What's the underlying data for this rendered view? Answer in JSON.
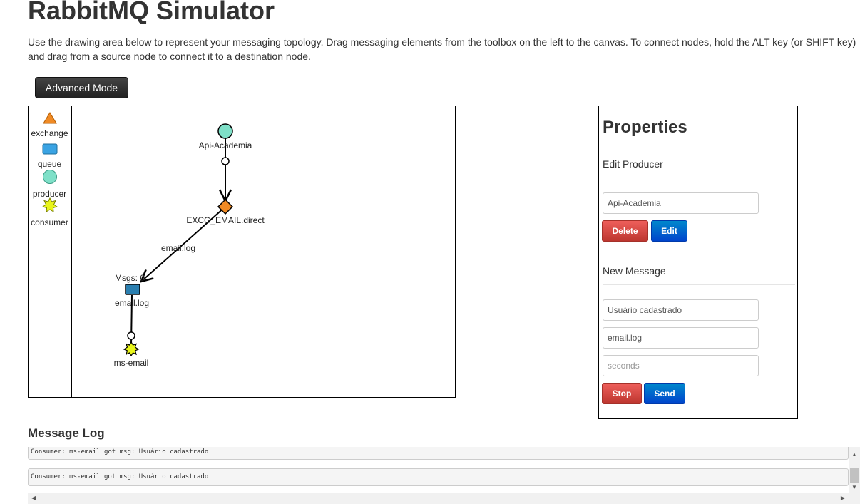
{
  "header": {
    "title": "RabbitMQ Simulator",
    "description": "Use the drawing area below to represent your messaging topology. Drag messaging elements from the toolbox on the left to the canvas. To connect nodes, hold the ALT key (or SHIFT key) and drag from a source node to connect it to a destination node.",
    "advanced_mode_label": "Advanced Mode"
  },
  "toolbox": {
    "items": [
      {
        "label": "exchange",
        "icon": "triangle-icon",
        "color": "#f08a24"
      },
      {
        "label": "queue",
        "icon": "rectangle-icon",
        "color": "#3aa3e3"
      },
      {
        "label": "producer",
        "icon": "circle-icon",
        "color": "#7fe0c8"
      },
      {
        "label": "consumer",
        "icon": "star-icon",
        "color": "#e8f51a"
      }
    ]
  },
  "diagram": {
    "nodes": {
      "producer": {
        "label": "Api-Academia",
        "color": "#7fe0c8"
      },
      "exchange": {
        "label": "EXCG_EMAIL.direct",
        "color": "#f08a24"
      },
      "queue": {
        "label": "email.log",
        "msgs_label": "Msgs: 0",
        "color": "#2a7fb0"
      },
      "consumer": {
        "label": "ms-email",
        "color": "#e8f51a"
      }
    },
    "binding_label": "email.log"
  },
  "properties": {
    "title": "Properties",
    "edit_section": "Edit Producer",
    "producer_name": "Api-Academia",
    "delete_label": "Delete",
    "edit_label": "Edit",
    "new_message_section": "New Message",
    "message_value": "Usuário cadastrado",
    "routing_key_value": "email.log",
    "seconds_placeholder": "seconds",
    "stop_label": "Stop",
    "send_label": "Send"
  },
  "log": {
    "title": "Message Log",
    "entries": [
      "Consumer: ms-email got msg:  Usuário cadastrado",
      "Consumer: ms-email got msg:  Usuário cadastrado"
    ]
  }
}
